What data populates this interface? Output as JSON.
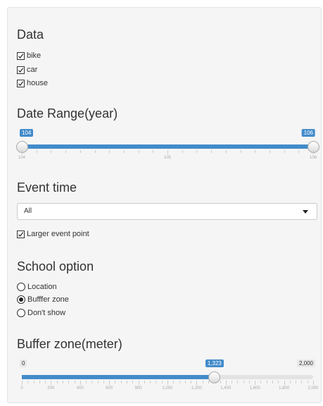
{
  "data_section": {
    "title": "Data",
    "options": [
      {
        "label": "bike",
        "checked": true
      },
      {
        "label": "car",
        "checked": true
      },
      {
        "label": "house",
        "checked": true
      }
    ]
  },
  "date_range": {
    "title": "Date Range(year)",
    "min": 104,
    "max": 106,
    "from": 104,
    "to": 106,
    "from_label": "104",
    "to_label": "106",
    "tick_labels": [
      "104",
      "105",
      "106"
    ]
  },
  "event_time": {
    "title": "Event time",
    "selected": "All",
    "larger_point_label": "Larger event point",
    "larger_point_checked": true
  },
  "school_option": {
    "title": "School option",
    "options": [
      {
        "label": "Location",
        "selected": false
      },
      {
        "label": "Bufffer zone",
        "selected": true
      },
      {
        "label": "Don't show",
        "selected": false
      }
    ]
  },
  "buffer_zone": {
    "title": "Buffer zone(meter)",
    "min": 0,
    "max": 2000,
    "value": 1323,
    "min_label": "0",
    "max_label": "2,000",
    "value_label": "1,323",
    "tick_labels": [
      "0",
      "200",
      "400",
      "600",
      "800",
      "1,000",
      "1,200",
      "1,400",
      "1,600",
      "1,800",
      "2,000"
    ]
  },
  "colors": {
    "accent": "#428bca",
    "panel": "#f5f5f5"
  }
}
